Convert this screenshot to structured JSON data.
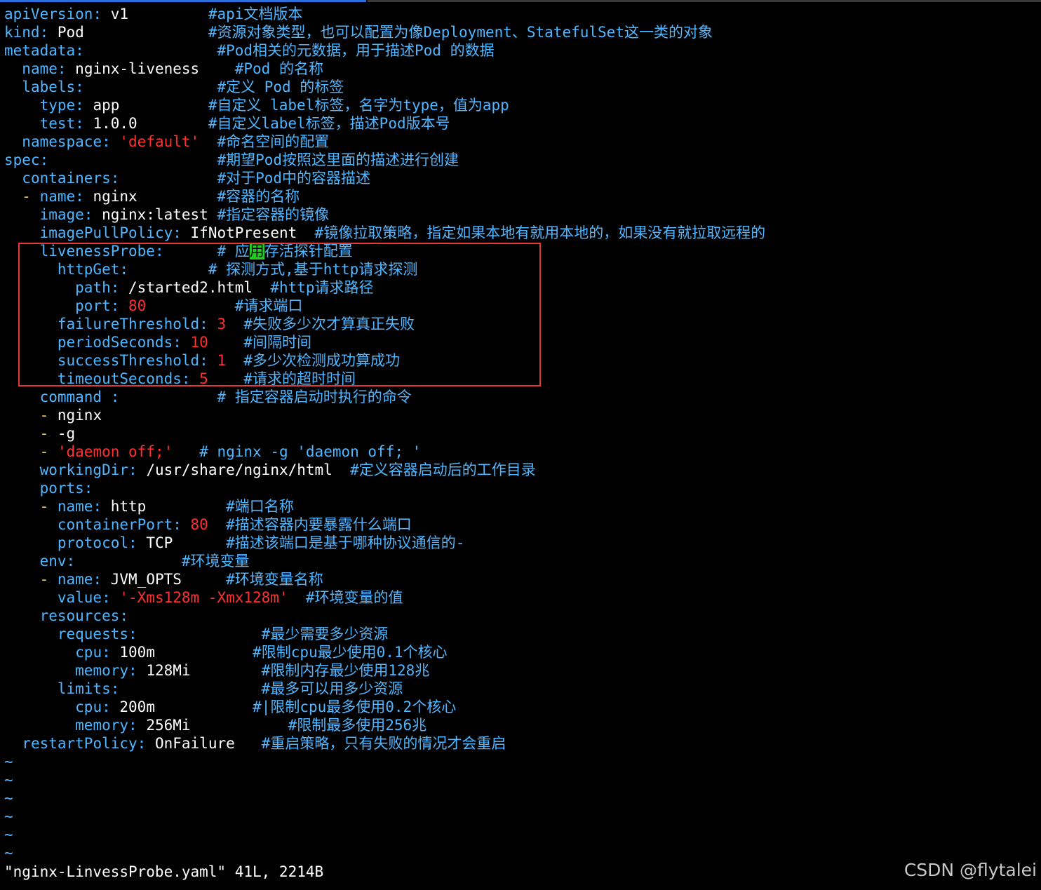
{
  "colors": {
    "background": "#000000",
    "key": "#4fb6ff",
    "comment": "#4fb6ff",
    "string": "#ff3030",
    "number": "#ff3030",
    "dash": "#f5c542",
    "text": "#ffffff",
    "cursor": "#22cc22",
    "highlight_box": "#e53935",
    "tab_line_active": "#2a6fdb",
    "tab_line": "#3a3a3a"
  },
  "lines": [
    [
      {
        "t": "k",
        "v": "apiVersion"
      },
      {
        "t": "p",
        "v": ": "
      },
      {
        "t": "v",
        "v": "v1         "
      },
      {
        "t": "c",
        "v": "#api文档版本"
      }
    ],
    [
      {
        "t": "k",
        "v": "kind"
      },
      {
        "t": "p",
        "v": ": "
      },
      {
        "t": "v",
        "v": "Pod              "
      },
      {
        "t": "c",
        "v": "#资源对象类型，也可以配置为像Deployment、StatefulSet这一类的对象"
      }
    ],
    [
      {
        "t": "k",
        "v": "metadata"
      },
      {
        "t": "p",
        "v": ":               "
      },
      {
        "t": "c",
        "v": "#Pod相关的元数据，用于描述Pod 的数据"
      }
    ],
    [
      {
        "t": "v",
        "v": "  "
      },
      {
        "t": "k",
        "v": "name"
      },
      {
        "t": "p",
        "v": ": "
      },
      {
        "t": "v",
        "v": "nginx-liveness    "
      },
      {
        "t": "c",
        "v": "#Pod 的名称"
      }
    ],
    [
      {
        "t": "v",
        "v": "  "
      },
      {
        "t": "k",
        "v": "labels"
      },
      {
        "t": "p",
        "v": ":               "
      },
      {
        "t": "c",
        "v": "#定义 Pod 的标签"
      }
    ],
    [
      {
        "t": "v",
        "v": "    "
      },
      {
        "t": "k",
        "v": "type"
      },
      {
        "t": "p",
        "v": ": "
      },
      {
        "t": "v",
        "v": "app          "
      },
      {
        "t": "c",
        "v": "#自定义 label标签，名字为type，值为app"
      }
    ],
    [
      {
        "t": "v",
        "v": "    "
      },
      {
        "t": "k",
        "v": "test"
      },
      {
        "t": "p",
        "v": ": "
      },
      {
        "t": "v",
        "v": "1.0.0        "
      },
      {
        "t": "c",
        "v": "#自定义label标签，描述Pod版本号"
      }
    ],
    [
      {
        "t": "v",
        "v": "  "
      },
      {
        "t": "k",
        "v": "namespace"
      },
      {
        "t": "p",
        "v": ": "
      },
      {
        "t": "s",
        "v": "'default'"
      },
      {
        "t": "v",
        "v": "  "
      },
      {
        "t": "c",
        "v": "#命名空间的配置"
      }
    ],
    [
      {
        "t": "k",
        "v": "spec"
      },
      {
        "t": "p",
        "v": ":                   "
      },
      {
        "t": "c",
        "v": "#期望Pod按照这里面的描述进行创建"
      }
    ],
    [
      {
        "t": "v",
        "v": "  "
      },
      {
        "t": "k",
        "v": "containers"
      },
      {
        "t": "p",
        "v": ":           "
      },
      {
        "t": "c",
        "v": "#对于Pod中的容器描述"
      }
    ],
    [
      {
        "t": "v",
        "v": "  "
      },
      {
        "t": "d",
        "v": "- "
      },
      {
        "t": "k",
        "v": "name"
      },
      {
        "t": "p",
        "v": ": "
      },
      {
        "t": "v",
        "v": "nginx         "
      },
      {
        "t": "c",
        "v": "#容器的名称"
      }
    ],
    [
      {
        "t": "v",
        "v": "    "
      },
      {
        "t": "k",
        "v": "image"
      },
      {
        "t": "p",
        "v": ": "
      },
      {
        "t": "v",
        "v": "nginx:latest "
      },
      {
        "t": "c",
        "v": "#指定容器的镜像"
      }
    ],
    [
      {
        "t": "v",
        "v": "    "
      },
      {
        "t": "k",
        "v": "imagePullPolicy"
      },
      {
        "t": "p",
        "v": ": "
      },
      {
        "t": "v",
        "v": "IfNotPresent  "
      },
      {
        "t": "c",
        "v": "#镜像拉取策略，指定如果本地有就用本地的，如果没有就拉取远程的"
      }
    ],
    [
      {
        "t": "v",
        "v": "    "
      },
      {
        "t": "k",
        "v": "livenessProbe"
      },
      {
        "t": "p",
        "v": ":      "
      },
      {
        "t": "c",
        "v": "# 应"
      },
      {
        "t": "cur",
        "v": "用"
      },
      {
        "t": "c",
        "v": "存活探针配置"
      }
    ],
    [
      {
        "t": "v",
        "v": "      "
      },
      {
        "t": "k",
        "v": "httpGet"
      },
      {
        "t": "p",
        "v": ":         "
      },
      {
        "t": "c",
        "v": "# 探测方式,基于http请求探测"
      }
    ],
    [
      {
        "t": "v",
        "v": "        "
      },
      {
        "t": "k",
        "v": "path"
      },
      {
        "t": "p",
        "v": ": "
      },
      {
        "t": "v",
        "v": "/started2.html  "
      },
      {
        "t": "c",
        "v": "#http请求路径"
      }
    ],
    [
      {
        "t": "v",
        "v": "        "
      },
      {
        "t": "k",
        "v": "port"
      },
      {
        "t": "p",
        "v": ": "
      },
      {
        "t": "n",
        "v": "80"
      },
      {
        "t": "v",
        "v": "          "
      },
      {
        "t": "c",
        "v": "#请求端口"
      }
    ],
    [
      {
        "t": "v",
        "v": "      "
      },
      {
        "t": "k",
        "v": "failureThreshold"
      },
      {
        "t": "p",
        "v": ": "
      },
      {
        "t": "n",
        "v": "3"
      },
      {
        "t": "v",
        "v": "  "
      },
      {
        "t": "c",
        "v": "#失败多少次才算真正失败"
      }
    ],
    [
      {
        "t": "v",
        "v": "      "
      },
      {
        "t": "k",
        "v": "periodSeconds"
      },
      {
        "t": "p",
        "v": ": "
      },
      {
        "t": "n",
        "v": "10"
      },
      {
        "t": "v",
        "v": "    "
      },
      {
        "t": "c",
        "v": "#间隔时间"
      }
    ],
    [
      {
        "t": "v",
        "v": "      "
      },
      {
        "t": "k",
        "v": "successThreshold"
      },
      {
        "t": "p",
        "v": ": "
      },
      {
        "t": "n",
        "v": "1"
      },
      {
        "t": "v",
        "v": "  "
      },
      {
        "t": "c",
        "v": "#多少次检测成功算成功"
      }
    ],
    [
      {
        "t": "v",
        "v": "      "
      },
      {
        "t": "k",
        "v": "timeoutSeconds"
      },
      {
        "t": "p",
        "v": ": "
      },
      {
        "t": "n",
        "v": "5"
      },
      {
        "t": "v",
        "v": "    "
      },
      {
        "t": "c",
        "v": "#请求的超时时间"
      }
    ],
    [
      {
        "t": "v",
        "v": "    "
      },
      {
        "t": "k",
        "v": "command"
      },
      {
        "t": "p",
        "v": " :           "
      },
      {
        "t": "c",
        "v": "# 指定容器启动时执行的命令"
      }
    ],
    [
      {
        "t": "v",
        "v": "    "
      },
      {
        "t": "d",
        "v": "- "
      },
      {
        "t": "v",
        "v": "nginx"
      }
    ],
    [
      {
        "t": "v",
        "v": "    "
      },
      {
        "t": "d",
        "v": "- "
      },
      {
        "t": "v",
        "v": "-g"
      }
    ],
    [
      {
        "t": "v",
        "v": "    "
      },
      {
        "t": "d",
        "v": "- "
      },
      {
        "t": "s",
        "v": "'daemon off;'"
      },
      {
        "t": "v",
        "v": "   "
      },
      {
        "t": "c",
        "v": "# nginx -g 'daemon off; '"
      }
    ],
    [
      {
        "t": "v",
        "v": "    "
      },
      {
        "t": "k",
        "v": "workingDir"
      },
      {
        "t": "p",
        "v": ": "
      },
      {
        "t": "v",
        "v": "/usr/share/nginx/html  "
      },
      {
        "t": "c",
        "v": "#定义容器启动后的工作目录"
      }
    ],
    [
      {
        "t": "v",
        "v": "    "
      },
      {
        "t": "k",
        "v": "ports"
      },
      {
        "t": "p",
        "v": ":"
      }
    ],
    [
      {
        "t": "v",
        "v": "    "
      },
      {
        "t": "d",
        "v": "- "
      },
      {
        "t": "k",
        "v": "name"
      },
      {
        "t": "p",
        "v": ": "
      },
      {
        "t": "v",
        "v": "http         "
      },
      {
        "t": "c",
        "v": "#端口名称"
      }
    ],
    [
      {
        "t": "v",
        "v": "      "
      },
      {
        "t": "k",
        "v": "containerPort"
      },
      {
        "t": "p",
        "v": ": "
      },
      {
        "t": "n",
        "v": "80"
      },
      {
        "t": "v",
        "v": "  "
      },
      {
        "t": "c",
        "v": "#描述容器内要暴露什么端口"
      }
    ],
    [
      {
        "t": "v",
        "v": "      "
      },
      {
        "t": "k",
        "v": "protocol"
      },
      {
        "t": "p",
        "v": ": "
      },
      {
        "t": "v",
        "v": "TCP      "
      },
      {
        "t": "c",
        "v": "#描述该端口是基于哪种协议通信的-"
      }
    ],
    [
      {
        "t": "v",
        "v": "    "
      },
      {
        "t": "k",
        "v": "env"
      },
      {
        "t": "p",
        "v": ":            "
      },
      {
        "t": "c",
        "v": "#环境变量"
      }
    ],
    [
      {
        "t": "v",
        "v": "    "
      },
      {
        "t": "d",
        "v": "- "
      },
      {
        "t": "k",
        "v": "name"
      },
      {
        "t": "p",
        "v": ": "
      },
      {
        "t": "v",
        "v": "JVM_OPTS     "
      },
      {
        "t": "c",
        "v": "#环境变量名称"
      }
    ],
    [
      {
        "t": "v",
        "v": "      "
      },
      {
        "t": "k",
        "v": "value"
      },
      {
        "t": "p",
        "v": ": "
      },
      {
        "t": "s",
        "v": "'-Xms128m -Xmx128m'"
      },
      {
        "t": "v",
        "v": "  "
      },
      {
        "t": "c",
        "v": "#环境变量的值"
      }
    ],
    [
      {
        "t": "v",
        "v": "    "
      },
      {
        "t": "k",
        "v": "resources"
      },
      {
        "t": "p",
        "v": ":"
      }
    ],
    [
      {
        "t": "v",
        "v": "      "
      },
      {
        "t": "k",
        "v": "requests"
      },
      {
        "t": "p",
        "v": ":              "
      },
      {
        "t": "c",
        "v": "#最少需要多少资源"
      }
    ],
    [
      {
        "t": "v",
        "v": "        "
      },
      {
        "t": "k",
        "v": "cpu"
      },
      {
        "t": "p",
        "v": ": "
      },
      {
        "t": "v",
        "v": "100m           "
      },
      {
        "t": "c",
        "v": "#限制cpu最少使用0.1个核心"
      }
    ],
    [
      {
        "t": "v",
        "v": "        "
      },
      {
        "t": "k",
        "v": "memory"
      },
      {
        "t": "p",
        "v": ": "
      },
      {
        "t": "v",
        "v": "128Mi        "
      },
      {
        "t": "c",
        "v": "#限制内存最少使用128兆"
      }
    ],
    [
      {
        "t": "v",
        "v": "      "
      },
      {
        "t": "k",
        "v": "limits"
      },
      {
        "t": "p",
        "v": ":                "
      },
      {
        "t": "c",
        "v": "#最多可以用多少资源"
      }
    ],
    [
      {
        "t": "v",
        "v": "        "
      },
      {
        "t": "k",
        "v": "cpu"
      },
      {
        "t": "p",
        "v": ": "
      },
      {
        "t": "v",
        "v": "200m           "
      },
      {
        "t": "c",
        "v": "#|限制cpu最多使用0.2个核心"
      }
    ],
    [
      {
        "t": "v",
        "v": "        "
      },
      {
        "t": "k",
        "v": "memory"
      },
      {
        "t": "p",
        "v": ": "
      },
      {
        "t": "v",
        "v": "256Mi           "
      },
      {
        "t": "c",
        "v": "#限制最多使用256兆"
      }
    ],
    [
      {
        "t": "v",
        "v": "  "
      },
      {
        "t": "k",
        "v": "restartPolicy"
      },
      {
        "t": "p",
        "v": ": "
      },
      {
        "t": "v",
        "v": "OnFailure   "
      },
      {
        "t": "c",
        "v": "#重启策略，只有失败的情况才会重启"
      }
    ],
    [
      {
        "t": "t",
        "v": "~"
      }
    ],
    [
      {
        "t": "t",
        "v": "~"
      }
    ],
    [
      {
        "t": "t",
        "v": "~"
      }
    ],
    [
      {
        "t": "t",
        "v": "~"
      }
    ],
    [
      {
        "t": "t",
        "v": "~"
      }
    ],
    [
      {
        "t": "t",
        "v": "~"
      }
    ]
  ],
  "status_line": "\"nginx-LinvessProbe.yaml\" 41L, 2214B",
  "watermark": "CSDN @flytalei"
}
